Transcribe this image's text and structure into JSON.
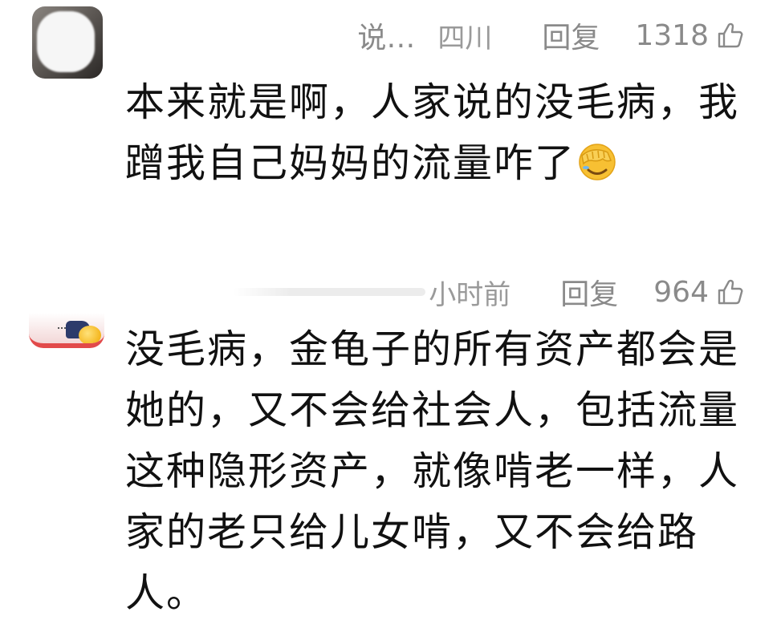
{
  "comments": [
    {
      "username_suffix": "说…",
      "location": "四川",
      "reply_label": "回复",
      "likes": "1318",
      "text_lines": [
        "本来就是啊，人家说的没毛病，我",
        "蹭我自己妈妈的流量咋了"
      ],
      "trailing_emoji": "facepalm-emoji"
    },
    {
      "time": "小时前",
      "reply_label": "回复",
      "likes": "964",
      "text_lines": [
        "没毛病，金龟子的所有资产都会是",
        "她的，又不会给社会人，包括流量",
        "这种隐形资产，就像啃老一样，人",
        "家的老只给儿女啃，又不会给路",
        "人。"
      ]
    }
  ],
  "colors": {
    "meta_text": "#8a8a8a",
    "body_text": "#111111",
    "avatar2_border": "#e24a4a",
    "emoji_yellow": "#f5b822"
  }
}
